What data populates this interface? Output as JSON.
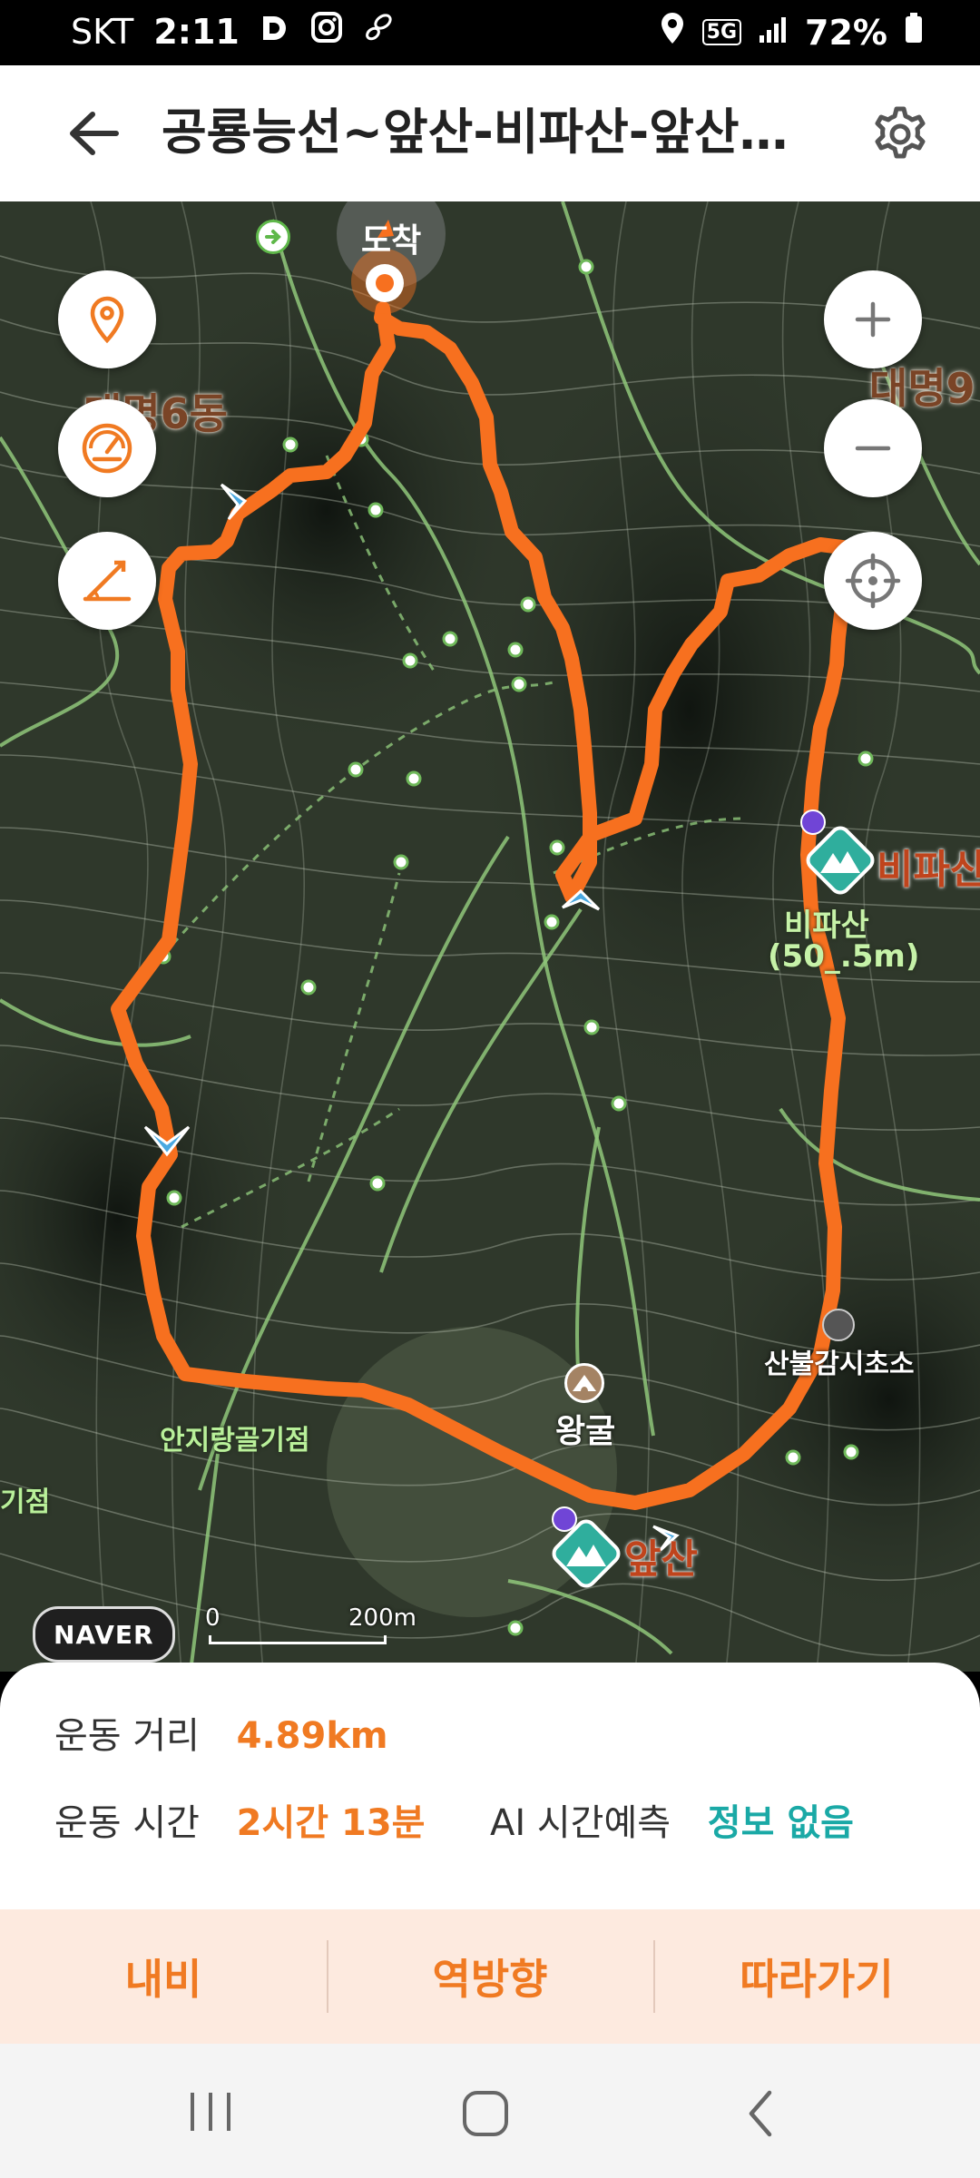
{
  "status_bar": {
    "carrier": "SKT",
    "time": "2:11",
    "network": "5G",
    "battery": "72%"
  },
  "header": {
    "title": "공룡능선~앞산-비파산-앞산…",
    "back_icon": "arrow-left-icon",
    "settings_icon": "gear-icon"
  },
  "map": {
    "labels": {
      "destination": "도착",
      "district_6": "대명6동",
      "district_9": "대명9",
      "peak_bipa": "비파산",
      "peak_bipa_name": "비파산",
      "peak_bipa_elev": "(50_.5m)",
      "cave": "왕굴",
      "peak_apsan": "앞산",
      "fire_post": "산불감시초소",
      "anjirang": "안지랑골기점",
      "left_edge": "기점"
    },
    "brand": "NAVER",
    "scale": {
      "zero": "0",
      "distance": "200m"
    },
    "controls": [
      "location-pin-icon",
      "speedometer-icon",
      "slope-icon"
    ],
    "zoom": [
      "plus-icon",
      "minus-icon",
      "crosshair-icon"
    ],
    "route_color": "#f7701f"
  },
  "stats": {
    "distance_label": "운동 거리",
    "distance_value": "4.89km",
    "time_label": "운동 시간",
    "time_value": "2시간 13분",
    "ai_label": "AI 시간예측",
    "ai_value": "정보 없음"
  },
  "actions": {
    "navi": "내비",
    "reverse": "역방향",
    "follow": "따라가기"
  },
  "nav_bar": [
    "recents-icon",
    "home-icon",
    "back-icon"
  ]
}
